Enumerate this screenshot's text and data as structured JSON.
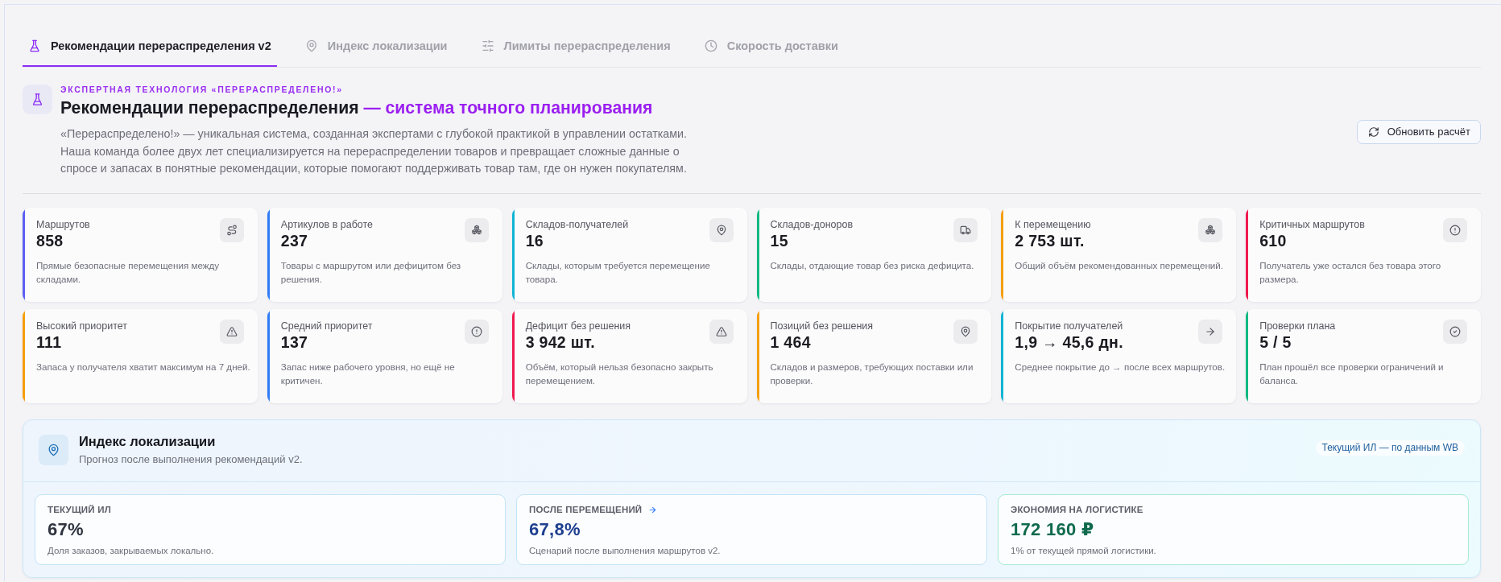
{
  "tabs": [
    {
      "label": "Рекомендации перераспределения v2",
      "selected": true
    },
    {
      "label": "Индекс локализации",
      "selected": false
    },
    {
      "label": "Лимиты перераспределения",
      "selected": false
    },
    {
      "label": "Скорость доставки",
      "selected": false
    }
  ],
  "header": {
    "eyebrow": "ЭКСПЕРТНАЯ ТЕХНОЛОГИЯ «ПЕРЕРАСПРЕДЕЛЕНО!»",
    "title": "Рекомендации перераспределения",
    "title_accent": "— система точного планирования",
    "description": "«Перераспределено!» — уникальная система, созданная экспертами с глубокой практикой в управлении остатками. Наша команда более двух лет специализируется на перераспределении товаров и превращает сложные данные о спросе и запасах в понятные рекомендации, которые помогают поддерживать товар там, где он нужен покупателям.",
    "button": "Обновить расчёт"
  },
  "stats": [
    {
      "label": "Маршрутов",
      "value": "858",
      "description": "Прямые безопасные перемещения между складами.",
      "color": "#5b5ff0"
    },
    {
      "label": "Артикулов в работе",
      "value": "237",
      "description": "Товары с маршрутом или дефицитом без решения.",
      "color": "#2f7cf6"
    },
    {
      "label": "Складов-получателей",
      "value": "16",
      "description": "Склады, которым требуется перемещение товара.",
      "color": "#0fb5d4"
    },
    {
      "label": "Складов-доноров",
      "value": "15",
      "description": "Склады, отдающие товар без риска дефицита.",
      "color": "#10b981"
    },
    {
      "label": "К перемещению",
      "value": "2 753 шт.",
      "description": "Общий объём рекомендованных перемещений.",
      "color": "#f59e0b"
    },
    {
      "label": "Критичных маршрутов",
      "value": "610",
      "description": "Получатель уже остался без товара этого размера.",
      "color": "#f0194f"
    },
    {
      "label": "Высокий приоритет",
      "value": "111",
      "description": "Запаса у получателя хватит максимум на 7 дней.",
      "color": "#f59e0b"
    },
    {
      "label": "Средний приоритет",
      "value": "137",
      "description": "Запас ниже рабочего уровня, но ещё не критичен.",
      "color": "#2f7cf6"
    },
    {
      "label": "Дефицит без решения",
      "value": "3 942 шт.",
      "description": "Объём, который нельзя безопасно закрыть перемещением.",
      "color": "#f0194f"
    },
    {
      "label": "Позиций без решения",
      "value": "1 464",
      "description": "Складов и размеров, требующих поставки или проверки.",
      "color": "#f59e0b"
    },
    {
      "label": "Покрытие получателей",
      "value": "1,9 → 45,6 дн.",
      "description": "Среднее покрытие до → после всех маршрутов.",
      "color": "#0fb5d4"
    },
    {
      "label": "Проверки плана",
      "value": "5 / 5",
      "description": "План прошёл все проверки ограничений и баланса.",
      "color": "#10b981"
    }
  ],
  "localization": {
    "title": "Индекс локализации",
    "subtitle": "Прогноз после выполнения рекомендаций v2.",
    "badge": "Текущий ИЛ — по данным WB",
    "metrics": [
      {
        "kind": "current",
        "label": "ТЕКУЩИЙ ИЛ",
        "value": "67%",
        "description": "Доля заказов, закрываемых локально."
      },
      {
        "kind": "forecast",
        "label": "ПОСЛЕ ПЕРЕМЕЩЕНИЙ",
        "value": "67,8%",
        "description": "Сценарий после выполнения маршрутов v2."
      },
      {
        "kind": "savings",
        "label": "ЭКОНОМИЯ НА ЛОГИСТИКЕ",
        "value": "172 160 ₽",
        "description": "1% от текущей прямой логистики."
      }
    ]
  }
}
